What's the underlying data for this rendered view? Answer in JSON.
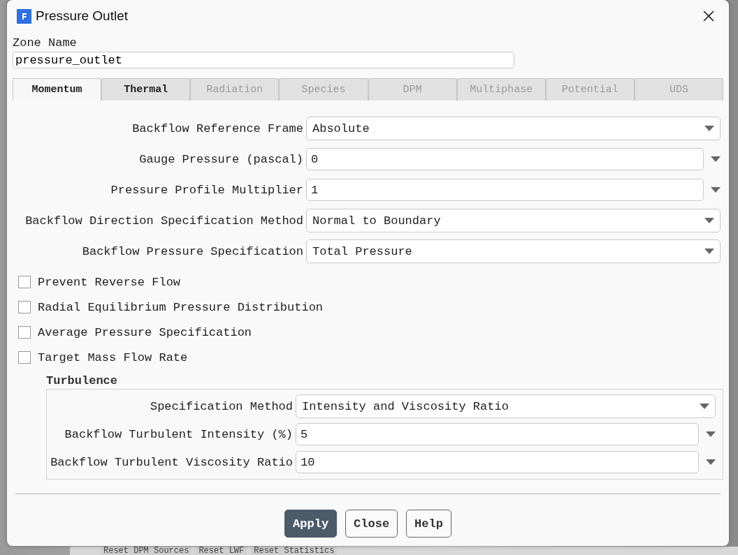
{
  "window": {
    "title": "Pressure Outlet"
  },
  "zone_name": {
    "label": "Zone Name",
    "value": "pressure_outlet"
  },
  "tabs": [
    {
      "label": "Momentum",
      "selected": true,
      "disabled": false
    },
    {
      "label": "Thermal",
      "selected": false,
      "disabled": false
    },
    {
      "label": "Radiation",
      "selected": false,
      "disabled": true
    },
    {
      "label": "Species",
      "selected": false,
      "disabled": true
    },
    {
      "label": "DPM",
      "selected": false,
      "disabled": true
    },
    {
      "label": "Multiphase",
      "selected": false,
      "disabled": true
    },
    {
      "label": "Potential",
      "selected": false,
      "disabled": true
    },
    {
      "label": "UDS",
      "selected": false,
      "disabled": true
    }
  ],
  "fields": [
    {
      "kind": "dropdown",
      "label": "Backflow Reference Frame",
      "value": "Absolute"
    },
    {
      "kind": "number",
      "label": "Gauge Pressure (pascal)",
      "value": "0"
    },
    {
      "kind": "number",
      "label": "Pressure Profile Multiplier",
      "value": "1"
    },
    {
      "kind": "dropdown",
      "label": "Backflow Direction Specification Method",
      "value": "Normal to Boundary"
    },
    {
      "kind": "dropdown",
      "label": "Backflow Pressure Specification",
      "value": "Total Pressure"
    }
  ],
  "options": [
    {
      "label": "Prevent Reverse Flow",
      "checked": false
    },
    {
      "label": "Radial Equilibrium Pressure Distribution",
      "checked": false
    },
    {
      "label": "Average Pressure Specification",
      "checked": false
    },
    {
      "label": "Target Mass Flow Rate",
      "checked": false
    }
  ],
  "turbulence": {
    "title": "Turbulence",
    "fields": [
      {
        "kind": "dropdown",
        "label": "Specification Method",
        "value": "Intensity and Viscosity Ratio"
      },
      {
        "kind": "number",
        "label": "Backflow Turbulent Intensity (%)",
        "value": "5"
      },
      {
        "kind": "number",
        "label": "Backflow Turbulent Viscosity Ratio",
        "value": "10"
      }
    ]
  },
  "buttons": [
    {
      "label": "Apply",
      "default": true
    },
    {
      "label": "Close",
      "default": false
    },
    {
      "label": "Help",
      "default": false
    }
  ],
  "background": {
    "buttons": [
      "Reset DPM Sources",
      "Reset LWF",
      "Reset Statistics"
    ]
  }
}
